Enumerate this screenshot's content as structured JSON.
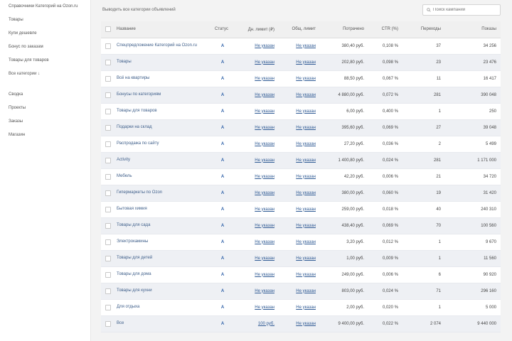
{
  "sidebar": {
    "items": [
      {
        "label": "Справочники Категорий на Ozon.ru",
        "multi": true
      },
      {
        "label": "Товары"
      },
      {
        "label": "Купи дешевле"
      },
      {
        "label": "Бонус по заказам"
      },
      {
        "label": "Товары для товаров"
      },
      {
        "label": "Все категории ↓"
      }
    ],
    "items2": [
      {
        "label": "Сводка"
      },
      {
        "label": "Проекты"
      },
      {
        "label": "Заказы"
      },
      {
        "label": "Магазин"
      }
    ]
  },
  "topbar": {
    "filter_text": "Выводить все категории объявлений",
    "search_placeholder": "Поиск кампаний",
    "search_icon": "search-icon"
  },
  "table": {
    "headers": [
      "Название",
      "Статус",
      "Дн. лимит (₽)",
      "Общ. лимит",
      "Потрачено",
      "CTR (%)",
      "Переходы",
      "Показы"
    ],
    "rows": [
      {
        "name": "Спецпредложение Категорий на Ozon.ru",
        "status": "А",
        "daily": "Не указан",
        "total": "Не указан",
        "spent": "380,40 руб.",
        "ctr": "0,108 %",
        "clicks": "37",
        "shows": "34 256"
      },
      {
        "name": "Товары",
        "status": "А",
        "daily": "Не указан",
        "total": "Не указан",
        "spent": "202,80 руб.",
        "ctr": "0,098 %",
        "clicks": "23",
        "shows": "23 476"
      },
      {
        "name": "Всё на квартиры",
        "status": "А",
        "daily": "Не указан",
        "total": "Не указан",
        "spent": "88,50 руб.",
        "ctr": "0,067 %",
        "clicks": "11",
        "shows": "16 417"
      },
      {
        "name": "Бонусы по категориям",
        "status": "А",
        "daily": "Не указан",
        "total": "Не указан",
        "spent": "4 880,00 руб.",
        "ctr": "0,072 %",
        "clicks": "281",
        "shows": "390 048"
      },
      {
        "name": "Товары для товаров",
        "status": "А",
        "daily": "Не указан",
        "total": "Не указан",
        "spent": "6,00 руб.",
        "ctr": "0,400 %",
        "clicks": "1",
        "shows": "250"
      },
      {
        "name": "Подарки на склад",
        "status": "А",
        "daily": "Не указан",
        "total": "Не указан",
        "spent": "395,60 руб.",
        "ctr": "0,069 %",
        "clicks": "27",
        "shows": "39 048"
      },
      {
        "name": "Распродажа по сайту",
        "status": "А",
        "daily": "Не указан",
        "total": "Не указан",
        "spent": "27,20 руб.",
        "ctr": "0,036 %",
        "clicks": "2",
        "shows": "5 499"
      },
      {
        "name": "Activity",
        "status": "А",
        "daily": "Не указан",
        "total": "Не указан",
        "spent": "1 400,80 руб.",
        "ctr": "0,024 %",
        "clicks": "281",
        "shows": "1 171 000"
      },
      {
        "name": "Мебель",
        "status": "А",
        "daily": "Не указан",
        "total": "Не указан",
        "spent": "42,20 руб.",
        "ctr": "0,006 %",
        "clicks": "21",
        "shows": "34 720"
      },
      {
        "name": "Гипермаркеты по Ozon",
        "status": "А",
        "daily": "Не указан",
        "total": "Не указан",
        "spent": "380,00 руб.",
        "ctr": "0,060 %",
        "clicks": "19",
        "shows": "31 420"
      },
      {
        "name": "Бытовая химия",
        "status": "А",
        "daily": "Не указан",
        "total": "Не указан",
        "spent": "259,00 руб.",
        "ctr": "0,018 %",
        "clicks": "40",
        "shows": "240 310"
      },
      {
        "name": "Товары для сада",
        "status": "А",
        "daily": "Не указан",
        "total": "Не указан",
        "spent": "438,40 руб.",
        "ctr": "0,069 %",
        "clicks": "70",
        "shows": "100 560"
      },
      {
        "name": "Электрокамины",
        "status": "А",
        "daily": "Не указан",
        "total": "Не указан",
        "spent": "3,20 руб.",
        "ctr": "0,012 %",
        "clicks": "1",
        "shows": "9 670"
      },
      {
        "name": "Товары для детей",
        "status": "А",
        "daily": "Не указан",
        "total": "Не указан",
        "spent": "1,00 руб.",
        "ctr": "0,009 %",
        "clicks": "1",
        "shows": "11 560"
      },
      {
        "name": "Товары для дома",
        "status": "А",
        "daily": "Не указан",
        "total": "Не указан",
        "spent": "249,00 руб.",
        "ctr": "0,006 %",
        "clicks": "6",
        "shows": "90 920"
      },
      {
        "name": "Товары для кухни",
        "status": "А",
        "daily": "Не указан",
        "total": "Не указан",
        "spent": "803,00 руб.",
        "ctr": "0,024 %",
        "clicks": "71",
        "shows": "296 160"
      },
      {
        "name": "Для отдыха",
        "status": "А",
        "daily": "Не указан",
        "total": "Не указан",
        "spent": "2,00 руб.",
        "ctr": "0,020 %",
        "clicks": "1",
        "shows": "5 000"
      },
      {
        "name": "Все",
        "status": "А",
        "daily": "100 руб.",
        "total": "Не указан",
        "spent": "9 400,00 руб.",
        "ctr": "0,022 %",
        "clicks": "2 074",
        "shows": "9 440 000"
      }
    ]
  }
}
